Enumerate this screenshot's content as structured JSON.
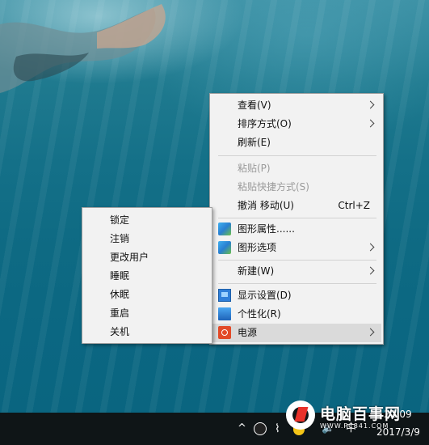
{
  "context_menu": {
    "items": [
      {
        "label": "查看(V)",
        "submenu": true
      },
      {
        "label": "排序方式(O)",
        "submenu": true
      },
      {
        "label": "刷新(E)"
      },
      {
        "label": "粘贴(P)",
        "disabled": true
      },
      {
        "label": "粘贴快捷方式(S)",
        "disabled": true
      },
      {
        "label": "撤消 移动(U)",
        "shortcut": "Ctrl+Z"
      },
      {
        "label": "图形属性......",
        "icon": "graphics-icon"
      },
      {
        "label": "图形选项",
        "icon": "graphics-icon",
        "submenu": true
      },
      {
        "label": "新建(W)",
        "submenu": true
      },
      {
        "label": "显示设置(D)",
        "icon": "display-icon"
      },
      {
        "label": "个性化(R)",
        "icon": "personalize-icon"
      },
      {
        "label": "电源",
        "icon": "power-icon",
        "submenu": true,
        "highlighted": true
      }
    ]
  },
  "power_submenu": {
    "items": [
      "锁定",
      "注销",
      "更改用户",
      "睡眠",
      "休眠",
      "重启",
      "关机"
    ]
  },
  "watermark": {
    "title": "电脑百事网",
    "url": "WWW.PC841.COM"
  },
  "taskbar": {
    "chevron": "^",
    "ime": "中",
    "time": "22:09",
    "date": "2017/3/9"
  },
  "brand": {
    "name": "电脑百事网",
    "url": "WWW.PC841.COM"
  },
  "colors": {
    "menu_bg": "#f2f2f2",
    "highlight": "#dadada",
    "disabled_text": "#9a9a9a",
    "taskbar": "#0f1517"
  }
}
